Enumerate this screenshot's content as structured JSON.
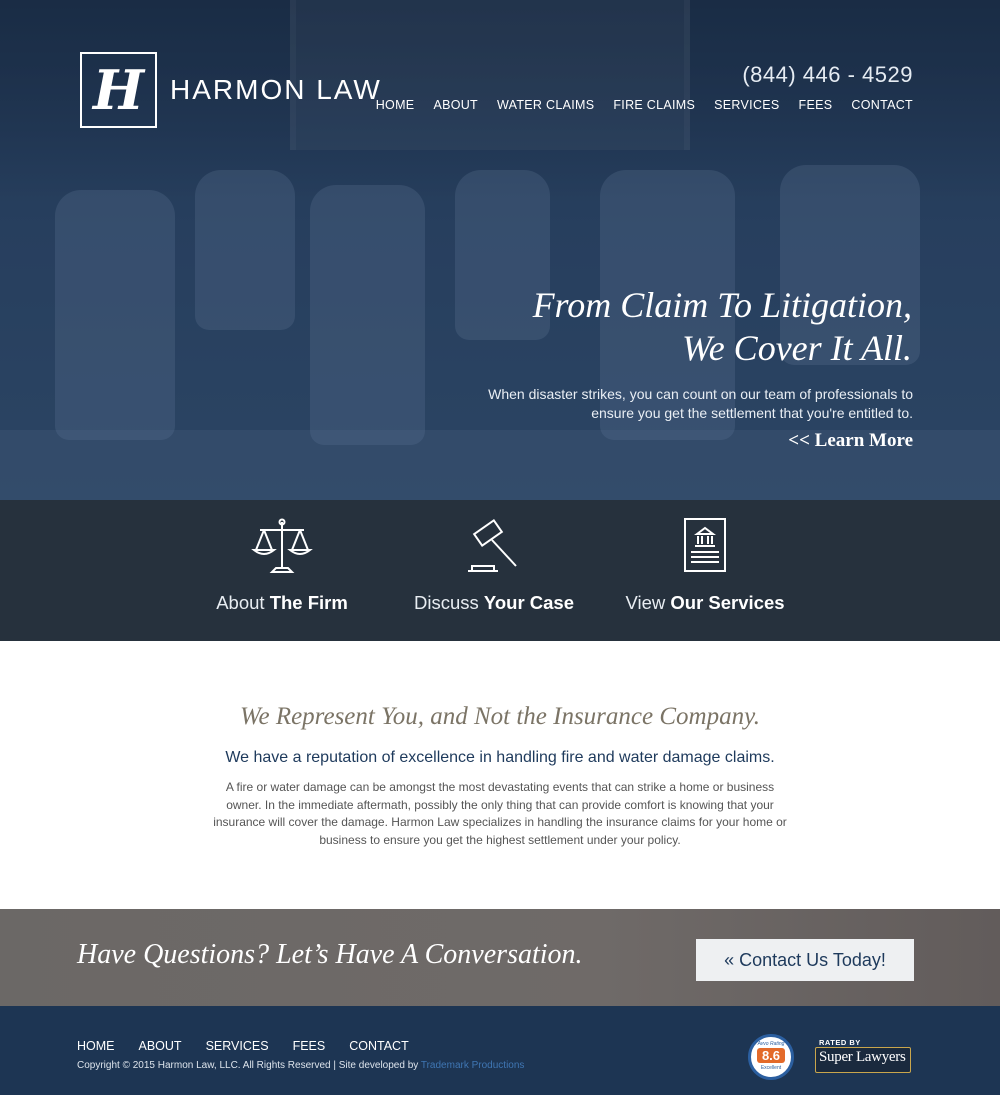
{
  "brand": {
    "logo_letter": "H",
    "name": "HARMON LAW"
  },
  "header": {
    "phone": "(844) 446 - 4529",
    "nav": [
      "HOME",
      "ABOUT",
      "WATER CLAIMS",
      "FIRE CLAIMS",
      "SERVICES",
      "FEES",
      "CONTACT"
    ]
  },
  "hero": {
    "headline_line1": "From Claim To Litigation,",
    "headline_line2": "We Cover It All.",
    "subtext": "When disaster strikes, you can count on our team of professionals to ensure you get the settlement that you're entitled to.",
    "link": "<< Learn More"
  },
  "features": [
    {
      "icon": "scales-icon",
      "light": "About ",
      "bold": "The Firm"
    },
    {
      "icon": "gavel-icon",
      "light": "Discuss ",
      "bold": "Your Case"
    },
    {
      "icon": "document-icon",
      "light": "View ",
      "bold": "Our Services"
    }
  ],
  "intro": {
    "title": "We Represent You, and Not the Insurance Company.",
    "subtitle": "We have a reputation of excellence in handling fire and water damage claims.",
    "body": "A fire or water damage can be amongst the most devastating events that can strike a home or business owner. In the immediate aftermath, possibly the only thing that can provide comfort is knowing that your insurance will cover the damage. Harmon Law specializes in handling the insurance claims for your home or business to ensure you get the highest settlement under your policy."
  },
  "cta": {
    "text": "Have Questions? Let’s Have A Conversation.",
    "button": "« Contact Us Today!"
  },
  "footer": {
    "nav": [
      "HOME",
      "ABOUT",
      "SERVICES",
      "FEES",
      "CONTACT"
    ],
    "copyright": "Copyright © 2015 Harmon Law, LLC. All Rights Reserved | Site developed by ",
    "developer": "Trademark Productions",
    "avvo": {
      "top": "Avvo Rating",
      "score": "8.6",
      "rating": "Excellent"
    },
    "superlawyers": {
      "rated_by": "RATED BY",
      "name": "Super Lawyers"
    }
  },
  "colors": {
    "hero_bg": "#2d4766",
    "feature_bar": "#26313d",
    "intro_title": "#7b7466",
    "intro_subtitle": "#1e3a5c",
    "cta_bg": "#6b6866",
    "footer_bg": "#1d3553",
    "link_blue": "#3f76b3"
  }
}
